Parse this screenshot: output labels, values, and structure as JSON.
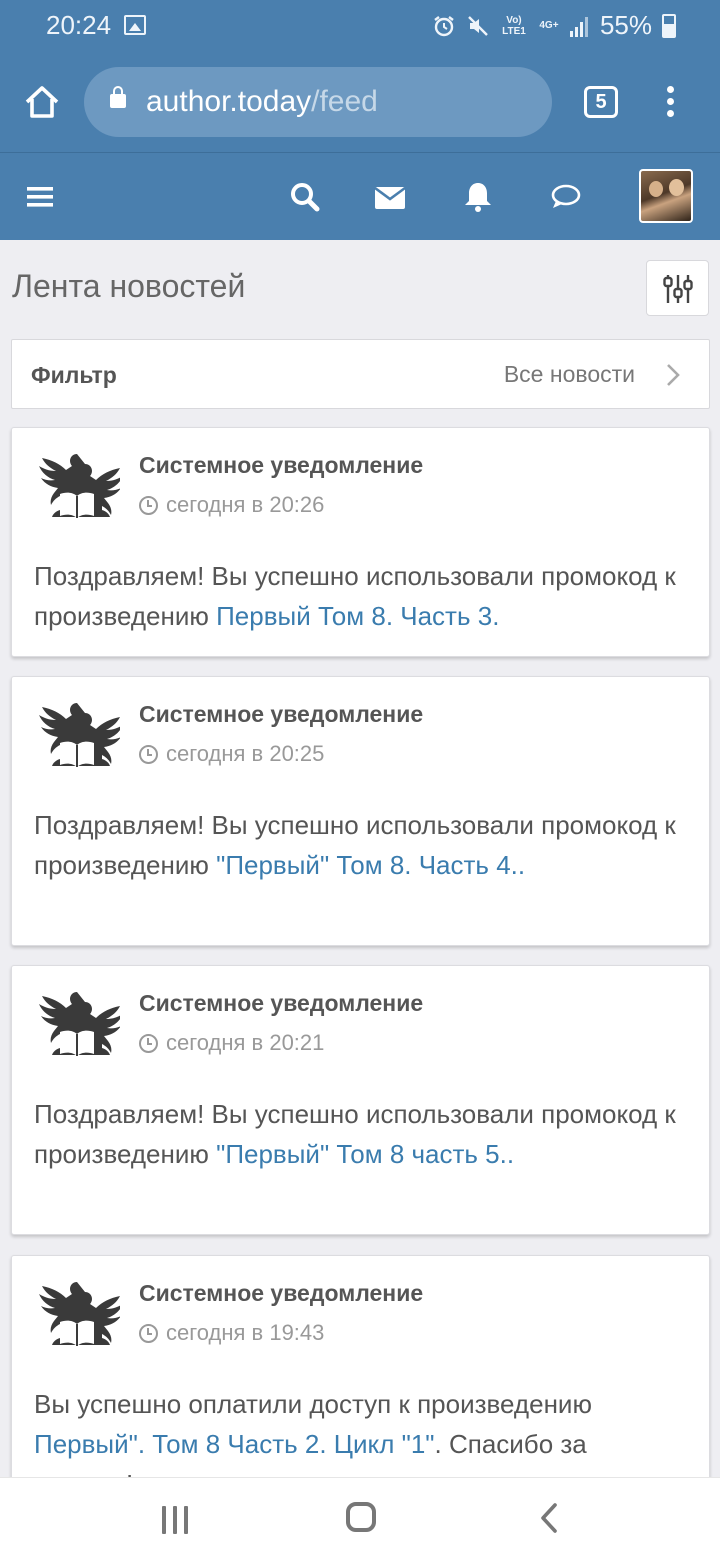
{
  "status_bar": {
    "time": "20:24",
    "network": "Vo) LTE1",
    "network_type": "4G+",
    "battery": "55%"
  },
  "browser": {
    "url_host": "author.today",
    "url_path": "/feed",
    "tab_count": "5"
  },
  "page": {
    "title": "Лента новостей",
    "filter_label": "Фильтр",
    "filter_value": "Все новости"
  },
  "feed": [
    {
      "author": "Системное уведомление",
      "time": "сегодня в 20:26",
      "text": "Поздравляем! Вы успешно использовали промокод к произведению ",
      "link": "Первый Том 8. Часть 3.",
      "text_after": ""
    },
    {
      "author": "Системное уведомление",
      "time": "сегодня в 20:25",
      "text": "Поздравляем! Вы успешно использовали промокод к произведению ",
      "link": "\"Первый\" Том 8. Часть 4..",
      "text_after": ""
    },
    {
      "author": "Системное уведомление",
      "time": "сегодня в 20:21",
      "text": "Поздравляем! Вы успешно использовали промокод к произведению ",
      "link": "\"Первый\" Том 8 часть 5..",
      "text_after": ""
    },
    {
      "author": "Системное уведомление",
      "time": "сегодня в 19:43",
      "text": "Вы успешно оплатили доступ к произведению ",
      "link": "Первый\". Том 8 Часть 2. Цикл \"1\"",
      "text_after": ". Спасибо за покупку!"
    }
  ],
  "colors": {
    "header": "#4a7fae",
    "link": "#3a7cae",
    "text": "#555555",
    "muted": "#999999",
    "background": "#eeeef2"
  },
  "icons": [
    "image-icon",
    "alarm-icon",
    "mute-icon",
    "signal-icon",
    "battery-icon",
    "home-icon",
    "lock-icon",
    "more-icon",
    "hamburger-icon",
    "search-icon",
    "mail-icon",
    "bell-icon",
    "chat-icon",
    "sliders-icon",
    "chevron-right-icon",
    "clock-icon",
    "eagle-book-logo-icon",
    "recent-apps-icon",
    "home-circle-icon",
    "back-icon"
  ]
}
